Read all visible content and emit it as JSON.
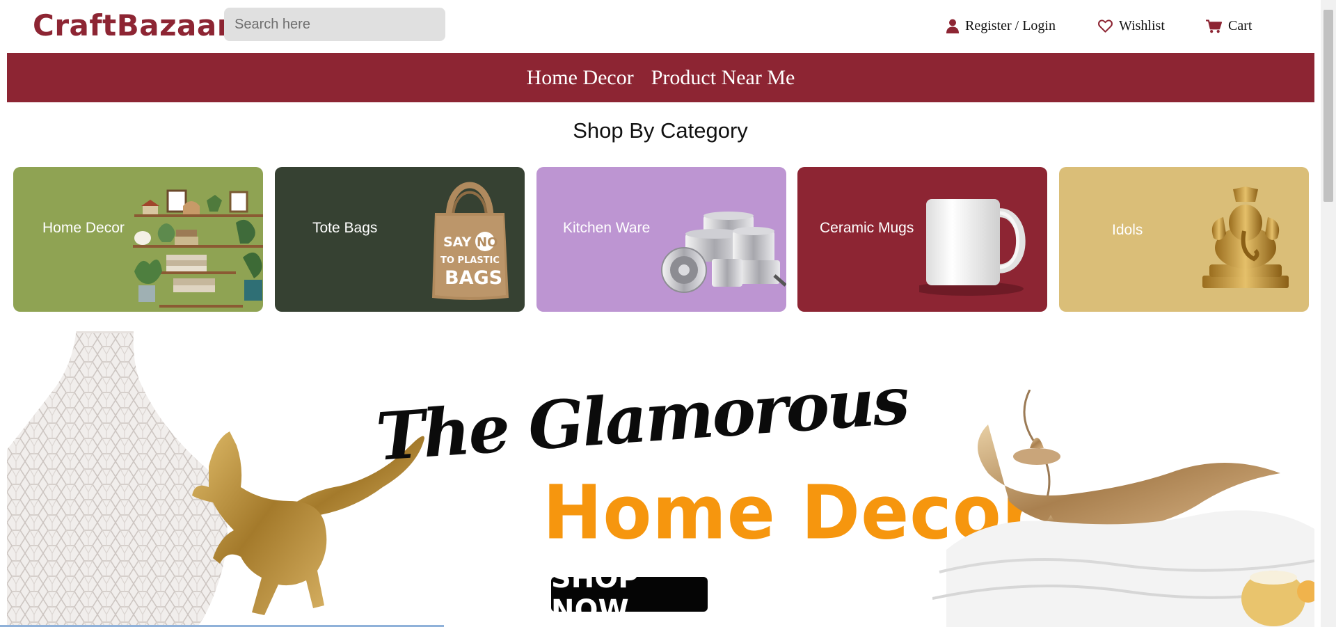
{
  "header": {
    "logo": "CraftBazaar",
    "search_placeholder": "Search here",
    "register_login": "Register / Login",
    "wishlist": "Wishlist",
    "cart": "Cart"
  },
  "nav": {
    "items": [
      "Home Decor",
      "Product Near Me"
    ]
  },
  "section_title": "Shop By Category",
  "categories": [
    {
      "label": "Home Decor",
      "color": "#8fa353",
      "icon": "shelf-decor-icon"
    },
    {
      "label": "Tote Bags",
      "color": "#364132",
      "icon": "tote-bag-icon"
    },
    {
      "label": "Kitchen Ware",
      "color": "#bd95d2",
      "icon": "cookware-icon"
    },
    {
      "label": "Ceramic Mugs",
      "color": "#8d2533",
      "icon": "mug-icon"
    },
    {
      "label": "Idols",
      "color": "#dabe78",
      "icon": "idol-icon"
    }
  ],
  "tote_bag_text": [
    "SAY",
    "NO",
    "TO PLASTIC",
    "BAGS"
  ],
  "banner": {
    "tagline_script": "The Glamorous",
    "tagline_bold": "Home Decor",
    "cta": "SHOP NOW"
  },
  "colors": {
    "brand": "#8d2533",
    "banner_accent": "#f6960e"
  }
}
